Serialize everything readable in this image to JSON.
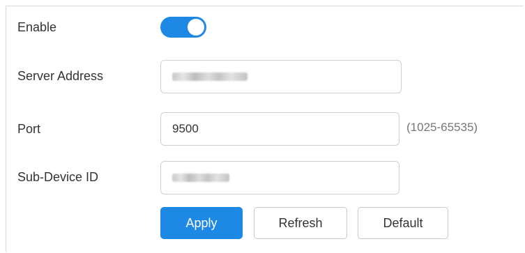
{
  "form": {
    "enable": {
      "label": "Enable",
      "state": "on",
      "accent": "#1e88e5"
    },
    "server_address": {
      "label": "Server Address",
      "value_obscured": true
    },
    "port": {
      "label": "Port",
      "value": "9500",
      "range_hint": "(1025-65535)"
    },
    "sub_device_id": {
      "label": "Sub-Device ID",
      "value_obscured": true
    }
  },
  "actions": {
    "apply_label": "Apply",
    "refresh_label": "Refresh",
    "default_label": "Default"
  },
  "colors": {
    "primary": "#1e88e5",
    "border": "#d0d0d0",
    "text": "#333333",
    "muted": "#777777"
  }
}
